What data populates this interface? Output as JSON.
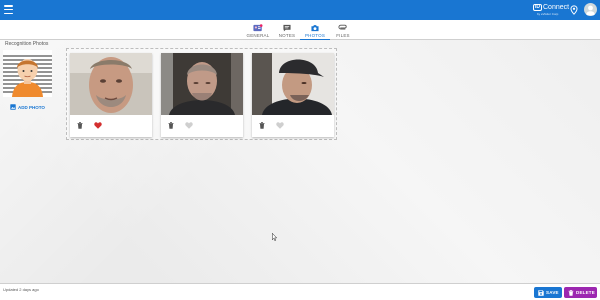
{
  "header": {
    "brand_name": "Connect",
    "brand_mark": "ID",
    "brand_sub": "by eVisitor Corp",
    "accent_color": "#1976d2",
    "icons": [
      "menu-icon",
      "location-icon",
      "user-avatar"
    ]
  },
  "tabs": [
    {
      "label": "GENERAL",
      "icon": "id-card-icon",
      "active": false
    },
    {
      "label": "NOTES",
      "icon": "notes-icon",
      "active": false
    },
    {
      "label": "PHOTOS",
      "icon": "camera-icon",
      "active": true
    },
    {
      "label": "FILES",
      "icon": "attachment-icon",
      "active": false
    }
  ],
  "main": {
    "section_title": "Recognition Photos",
    "add_photo_label": "ADD PHOTO",
    "photos": [
      {
        "favorite": true
      },
      {
        "favorite": false
      },
      {
        "favorite": false
      }
    ]
  },
  "footer": {
    "updated_text": "Updated 2 days ago",
    "save_label": "SAVE",
    "delete_label": "DELETE",
    "save_color": "#1976d2",
    "delete_color": "#9c27b0"
  }
}
